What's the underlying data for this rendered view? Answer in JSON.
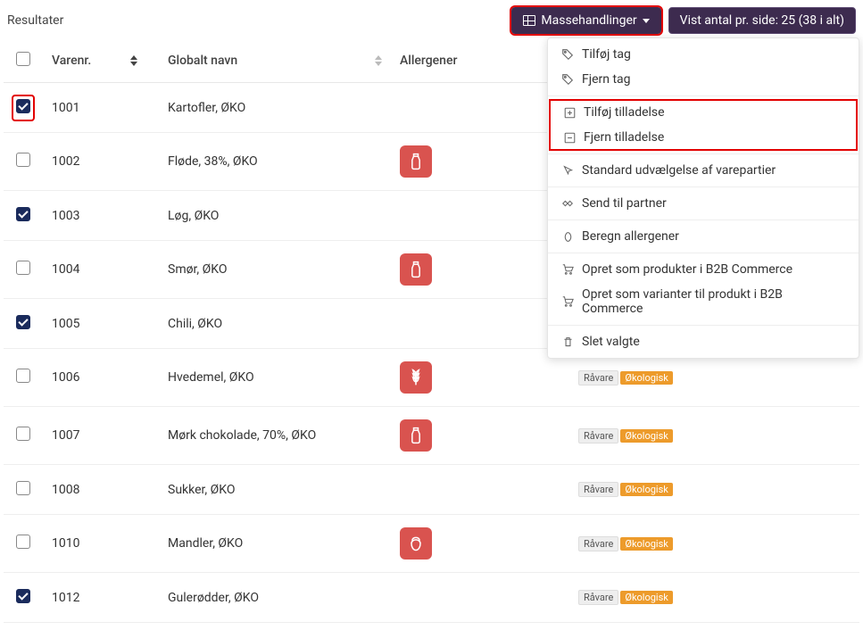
{
  "results_label": "Resultater",
  "buttons": {
    "bulk_actions": "Massehandlinger",
    "page_info": "Vist antal pr. side: 25 (38 i alt)"
  },
  "columns": {
    "varenr": "Varenr.",
    "globalt_navn": "Globalt navn",
    "allergener": "Allergener"
  },
  "dropdown": {
    "tilfoj_tag": "Tilføj tag",
    "fjern_tag": "Fjern tag",
    "tilfoj_tilladelse": "Tilføj tilladelse",
    "fjern_tilladelse": "Fjern tilladelse",
    "standard_udvaelgelse": "Standard udvælgelse af varepartier",
    "send_til_partner": "Send til partner",
    "beregn_allergener": "Beregn allergener",
    "opret_produkter": "Opret som produkter i B2B Commerce",
    "opret_varianter": "Opret som varianter til produkt i B2B Commerce",
    "slet_valgte": "Slet valgte"
  },
  "tags": {
    "raavare": "Råvare",
    "okologisk": "Økologisk"
  },
  "rows": [
    {
      "checked": true,
      "highlight": true,
      "varenr": "1001",
      "navn": "Kartofler, ØKO",
      "allergen": null,
      "show_tags": false
    },
    {
      "checked": false,
      "highlight": false,
      "varenr": "1002",
      "navn": "Fløde, 38%, ØKO",
      "allergen": "milk",
      "show_tags": false
    },
    {
      "checked": true,
      "highlight": false,
      "varenr": "1003",
      "navn": "Løg, ØKO",
      "allergen": null,
      "show_tags": false
    },
    {
      "checked": false,
      "highlight": false,
      "varenr": "1004",
      "navn": "Smør, ØKO",
      "allergen": "milk",
      "show_tags": false
    },
    {
      "checked": true,
      "highlight": false,
      "varenr": "1005",
      "navn": "Chili, ØKO",
      "allergen": null,
      "show_tags": false
    },
    {
      "checked": false,
      "highlight": false,
      "varenr": "1006",
      "navn": "Hvedemel, ØKO",
      "allergen": "wheat",
      "show_tags": true
    },
    {
      "checked": false,
      "highlight": false,
      "varenr": "1007",
      "navn": "Mørk chokolade, 70%, ØKO",
      "allergen": "milk",
      "show_tags": true
    },
    {
      "checked": false,
      "highlight": false,
      "varenr": "1008",
      "navn": "Sukker, ØKO",
      "allergen": null,
      "show_tags": true
    },
    {
      "checked": false,
      "highlight": false,
      "varenr": "1010",
      "navn": "Mandler, ØKO",
      "allergen": "nut",
      "show_tags": true
    },
    {
      "checked": true,
      "highlight": false,
      "varenr": "1012",
      "navn": "Gulerødder, ØKO",
      "allergen": null,
      "show_tags": true
    }
  ]
}
